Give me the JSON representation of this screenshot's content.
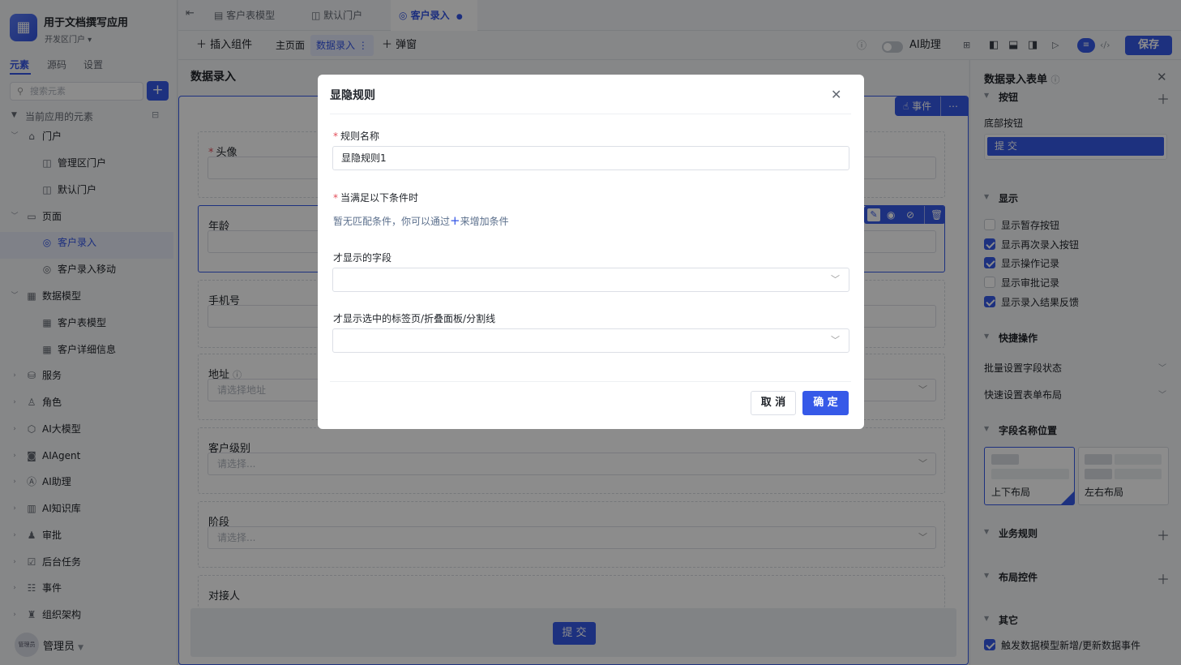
{
  "app": {
    "name": "用于文档撰写应用",
    "portal": "开发区门户 ▾",
    "logo_icon": "app-logo-icon"
  },
  "left_tabs": [
    "元素",
    "源码",
    "设置"
  ],
  "search": {
    "placeholder": "搜索元素"
  },
  "tree_header": "当前应用的元素",
  "tree": [
    {
      "label": "门户",
      "icon": "home-icon",
      "level": 0,
      "expanded": true
    },
    {
      "label": "管理区门户",
      "icon": "portal-icon",
      "level": 1
    },
    {
      "label": "默认门户",
      "icon": "portal-icon",
      "level": 1
    },
    {
      "label": "页面",
      "icon": "page-icon",
      "level": 0,
      "expanded": true
    },
    {
      "label": "客户录入",
      "icon": "form-icon",
      "level": 1,
      "selected": true
    },
    {
      "label": "客户录入移动",
      "icon": "form-icon",
      "level": 1
    },
    {
      "label": "数据模型",
      "icon": "table-icon",
      "level": 0,
      "expanded": true
    },
    {
      "label": "客户表模型",
      "icon": "table-icon",
      "level": 1
    },
    {
      "label": "客户详细信息",
      "icon": "table-icon",
      "level": 1
    },
    {
      "label": "服务",
      "icon": "service-icon",
      "level": 0
    },
    {
      "label": "角色",
      "icon": "role-icon",
      "level": 0
    },
    {
      "label": "AI大模型",
      "icon": "ai-model-icon",
      "level": 0
    },
    {
      "label": "AIAgent",
      "icon": "robot-icon",
      "level": 0
    },
    {
      "label": "AI助理",
      "icon": "ai-assistant-icon",
      "level": 0
    },
    {
      "label": "AI知识库",
      "icon": "book-icon",
      "level": 0
    },
    {
      "label": "审批",
      "icon": "stamp-icon",
      "level": 0
    },
    {
      "label": "后台任务",
      "icon": "task-icon",
      "level": 0
    },
    {
      "label": "事件",
      "icon": "event-icon",
      "level": 0
    },
    {
      "label": "组织架构",
      "icon": "org-icon",
      "level": 0
    }
  ],
  "user": {
    "name": "管理员",
    "avatar_text": "管理员"
  },
  "top_tabs": [
    {
      "label": "客户表模型",
      "icon": "table-icon"
    },
    {
      "label": "默认门户",
      "icon": "portal-icon"
    },
    {
      "label": "客户录入",
      "icon": "form-icon",
      "active": true
    }
  ],
  "toolbar": {
    "insert": "插入组件",
    "home": "主页面",
    "entry": "数据录入",
    "popup": "弹窗",
    "ai_assistant": "AI助理",
    "save": "保存"
  },
  "form": {
    "title": "数据录入",
    "event_button": "事件",
    "fields": [
      {
        "label": "头像",
        "required": true,
        "placeholder": ""
      },
      {
        "label": "年龄",
        "placeholder": ""
      },
      {
        "label": "手机号",
        "placeholder": ""
      },
      {
        "label": "地址",
        "placeholder": "请选择地址"
      },
      {
        "label": "客户级别",
        "placeholder": "请选择..."
      },
      {
        "label": "阶段",
        "placeholder": "请选择..."
      },
      {
        "label": "对接人",
        "placeholder": ""
      }
    ],
    "submit": "提 交"
  },
  "right_panel": {
    "title": "数据录入表单",
    "sections": {
      "buttons": "按钮",
      "bottom_buttons": "底部按钮",
      "submit": "提 交",
      "display": "显示",
      "quick_ops": "快捷操作",
      "label_position": "字段名称位置",
      "business_rules": "业务规则",
      "layout_controls": "布局控件",
      "others": "其它"
    },
    "display_options": [
      {
        "label": "显示暂存按钮",
        "checked": false
      },
      {
        "label": "显示再次录入按钮",
        "checked": true
      },
      {
        "label": "显示操作记录",
        "checked": true
      },
      {
        "label": "显示审批记录",
        "checked": false
      },
      {
        "label": "显示录入结果反馈",
        "checked": true
      }
    ],
    "quick_options": [
      "批量设置字段状态",
      "快速设置表单布局"
    ],
    "layouts": [
      {
        "label": "上下布局",
        "selected": true
      },
      {
        "label": "左右布局",
        "selected": false
      }
    ],
    "other_option": {
      "label": "触发数据模型新增/更新数据事件",
      "checked": true
    }
  },
  "modal": {
    "title": "显隐规则",
    "rule_name_label": "规则名称",
    "rule_name_value": "显隐规则1",
    "condition_label": "当满足以下条件时",
    "no_condition_a": "暂无匹配条件，你可以通过",
    "no_condition_plus": "+",
    "no_condition_b": "来增加条件",
    "fields_label": "才显示的字段",
    "tabs_label": "才显示选中的标签页/折叠面板/分割线",
    "cancel": "取 消",
    "ok": "确 定"
  },
  "colors": {
    "accent": "#3659e8",
    "overlay": "rgba(0,0,0,0.45)"
  }
}
